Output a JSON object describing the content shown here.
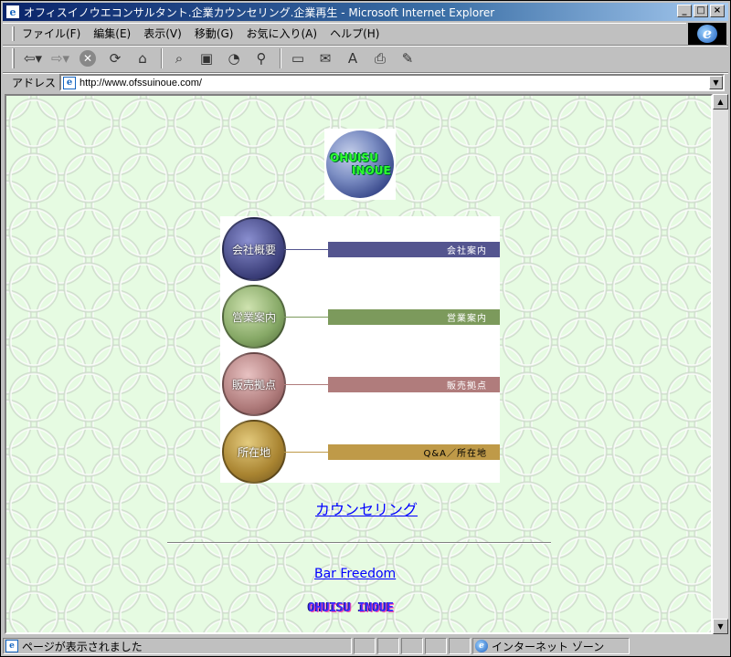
{
  "window": {
    "title": "オフィスイノウエコンサルタント.企業カウンセリング.企業再生 - Microsoft Internet Explorer",
    "min_label": "_",
    "max_label": "□",
    "close_label": "×"
  },
  "menu": [
    "ファイル(F)",
    "編集(E)",
    "表示(V)",
    "移動(G)",
    "お気に入り(A)",
    "ヘルプ(H)"
  ],
  "toolbar": {
    "icons": [
      "back-icon",
      "forward-icon",
      "stop-icon",
      "refresh-icon",
      "home-icon",
      "search-icon",
      "favorites-icon",
      "history-icon",
      "channels-icon",
      "fullscreen-icon",
      "mail-icon",
      "font-icon",
      "print-icon",
      "edit-icon"
    ]
  },
  "address": {
    "label": "アドレス",
    "url": "http://www.ofssuinoue.com/"
  },
  "page": {
    "logo_line1": "OHUISU",
    "logo_line2": "INOUE",
    "nav": [
      {
        "circle_label": "会社概要",
        "bar_label": "会社案内",
        "color": "#54558f"
      },
      {
        "circle_label": "営業案内",
        "bar_label": "営業案内",
        "color": "#7c9a5c"
      },
      {
        "circle_label": "販売拠点",
        "bar_label": "販売拠点",
        "color": "#b07c7c"
      },
      {
        "circle_label": "所在地",
        "bar_label": "Q&A／所在地",
        "color": "#bf9a48"
      }
    ],
    "counseling_link": "カウンセリング",
    "bar_link": "Bar Freedom",
    "footer_logo": "OHUISU INOUE"
  },
  "status": {
    "text": "ページが表示されました",
    "zone": "インターネット ゾーン"
  }
}
